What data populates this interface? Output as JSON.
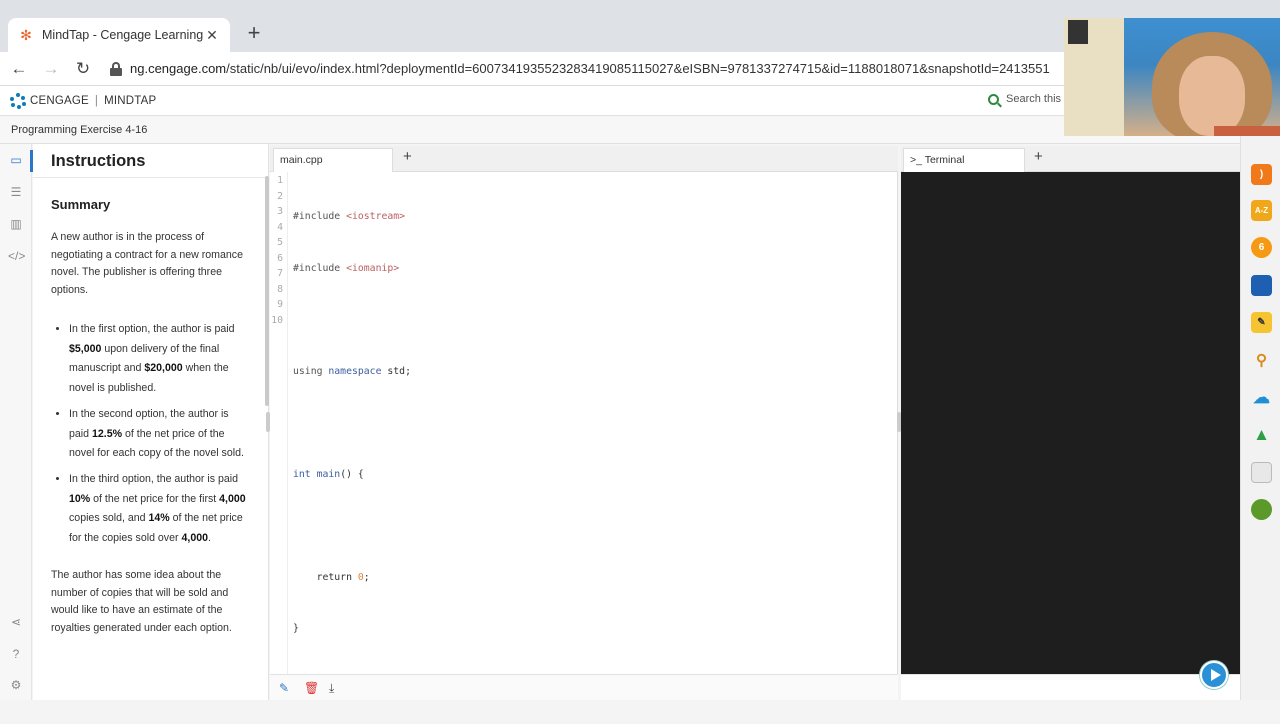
{
  "browser": {
    "tab_title": "MindTap - Cengage Learning",
    "tab_close": "✕",
    "new_tab": "+",
    "url_host": "ng.cengage.com",
    "url_path": "/static/nb/ui/evo/index.html?deploymentId=600734193552328341908511502​7&eISBN=9781337274715&id=1188018071&snapshotId=2413551"
  },
  "header": {
    "brand": "CENGAGE",
    "divider": "|",
    "product": "MINDTAP",
    "search_placeholder": "Search this c"
  },
  "subheader": {
    "title": "Programming Exercise 4-16"
  },
  "instructions": {
    "heading": "Instructions",
    "summary_heading": "Summary",
    "intro": "A new author is in the process of negotiating a contract for a new romance novel. The publisher is offering three options.",
    "options": [
      {
        "pre": "In the first option, the author is paid ",
        "b1": "$5,000",
        "mid": " upon delivery of the final manuscript and ",
        "b2": "$20,000",
        "mid2": " when the novel is published.",
        "b3": "",
        "post": "",
        "b4": "",
        "end": ""
      },
      {
        "pre": "In the second option, the author is paid ",
        "b1": "12.5%",
        "mid": " of the net price of the novel for each copy of the novel sold.",
        "b2": "",
        "mid2": "",
        "b3": "",
        "post": "",
        "b4": "",
        "end": ""
      },
      {
        "pre": "In the third option, the author is paid ",
        "b1": "10%",
        "mid": " of the net price for the first ",
        "b2": "4,000",
        "mid2": " copies sold, and ",
        "b3": "14%",
        "post": " of the net price for the copies sold over ",
        "b4": "4,000",
        "end": "."
      }
    ],
    "closing": "The author has some idea about the number of copies that will be sold and would like to have an estimate of the royalties generated under each option."
  },
  "editor": {
    "tab": "main.cpp",
    "add_tab": "+",
    "line_numbers": [
      "1",
      "2",
      "3",
      "4",
      "5",
      "6",
      "7",
      "8",
      "9",
      "10"
    ],
    "code": {
      "l1_pp": "#include ",
      "l1_str": "<iostream>",
      "l2_pp": "#include ",
      "l2_str": "<iomanip>",
      "l4_kw1": "using ",
      "l4_kw2": "namespace",
      "l4_rest": " std;",
      "l6_kw": "int ",
      "l6_fn": "main",
      "l6_rest": "() {",
      "l8_ind": "    ",
      "l8_kw": "return ",
      "l8_num": "0",
      "l8_rest": ";",
      "l9": "}"
    }
  },
  "terminal": {
    "tab": "Terminal",
    "prompt_glyph": ">_",
    "add_tab": "+"
  },
  "colors": {
    "accent": "#2a77c9",
    "terminal_bg": "#1e1e1e",
    "play": "#2a90d8"
  },
  "icons": {
    "rail": [
      "book-icon",
      "list-icon",
      "chart-icon",
      "code-icon",
      "share-icon",
      "help-icon",
      "settings-icon"
    ],
    "dock": [
      "rss-icon",
      "a-z-icon",
      "six-icon",
      "book-icon",
      "notes-icon",
      "signal-icon",
      "cloud-icon",
      "drive-icon",
      "page-icon",
      "circle-app-icon"
    ],
    "dock_labels": {
      "az": "A-Z",
      "six": "6"
    }
  }
}
